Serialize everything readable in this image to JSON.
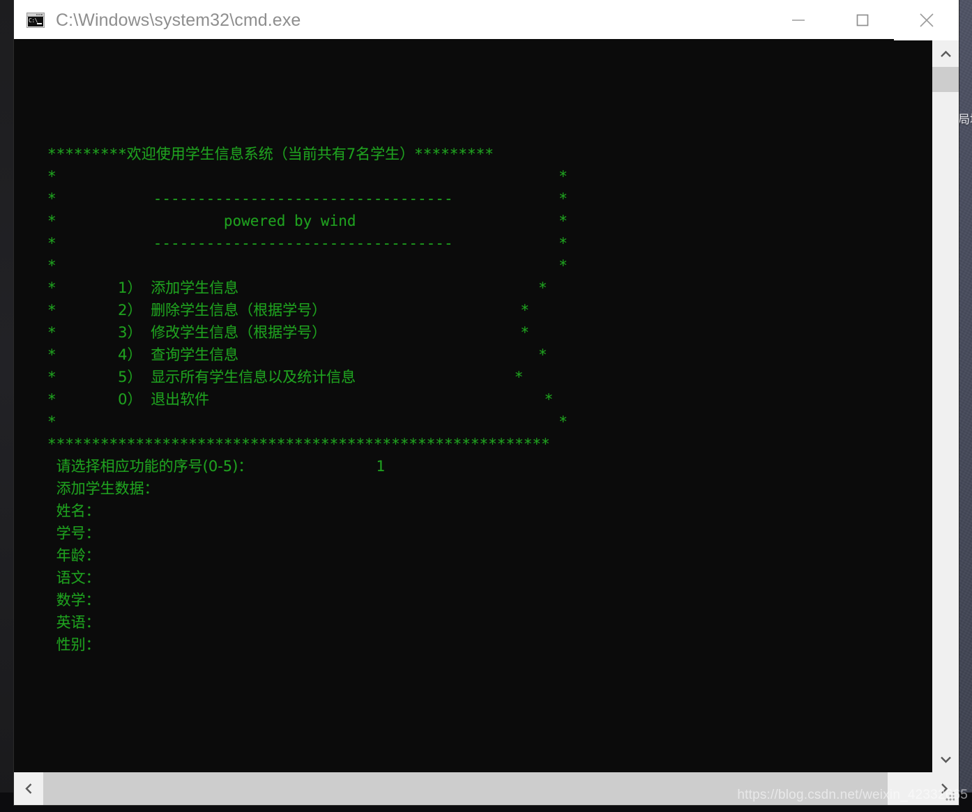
{
  "window": {
    "title": "C:\\Windows\\system32\\cmd.exe",
    "icon": "cmd-console-icon",
    "icon_text": "C:\\",
    "controls": {
      "minimize_label": "Minimize",
      "maximize_label": "Maximize",
      "close_label": "Close"
    }
  },
  "colors": {
    "console_background": "#0b0b0b",
    "console_foreground": "#1fa01f",
    "titlebar_background": "#ffffff",
    "titlebar_text": "#8e8e8e",
    "scrollbar_track": "#f0f0f0",
    "scrollbar_thumb": "#cdcdcd",
    "desktop": "#4a4e60"
  },
  "console": {
    "banner": {
      "asterisk_left": "*********",
      "heading": "欢迎使用学生信息系统（当前共有7名学生）",
      "asterisk_right": "*********",
      "student_count": "7"
    },
    "subtitle": "powered by wind",
    "divider": "----------------------------------",
    "menu": [
      {
        "key": "1）",
        "label": "添加学生信息"
      },
      {
        "key": "2）",
        "label": "删除学生信息（根据学号）"
      },
      {
        "key": "3）",
        "label": "修改学生信息（根据学号）"
      },
      {
        "key": "4）",
        "label": "查询学生信息"
      },
      {
        "key": "5）",
        "label": "显示所有学生信息以及统计信息"
      },
      {
        "key": "0）",
        "label": "退出软件"
      }
    ],
    "bottom_border": "*********************************************************",
    "prompt": {
      "label": "请选择相应功能的序号(0-5)：",
      "value": "1"
    },
    "section_title": "添加学生数据：",
    "fields": [
      {
        "label": "姓名：",
        "value": ""
      },
      {
        "label": "学号：",
        "value": ""
      },
      {
        "label": "年龄：",
        "value": ""
      },
      {
        "label": "语文：",
        "value": ""
      },
      {
        "label": "数学：",
        "value": ""
      },
      {
        "label": "英语：",
        "value": ""
      },
      {
        "label": "性别：",
        "value": ""
      }
    ]
  },
  "scrollbars": {
    "vertical": {
      "up_arrow": "▲",
      "down_arrow": "▼"
    },
    "horizontal": {
      "left_arrow": "◀",
      "right_arrow": "▶"
    }
  },
  "watermark": "https://blog.csdn.net/weixin_42332665",
  "desktop_glyphs": "局填"
}
